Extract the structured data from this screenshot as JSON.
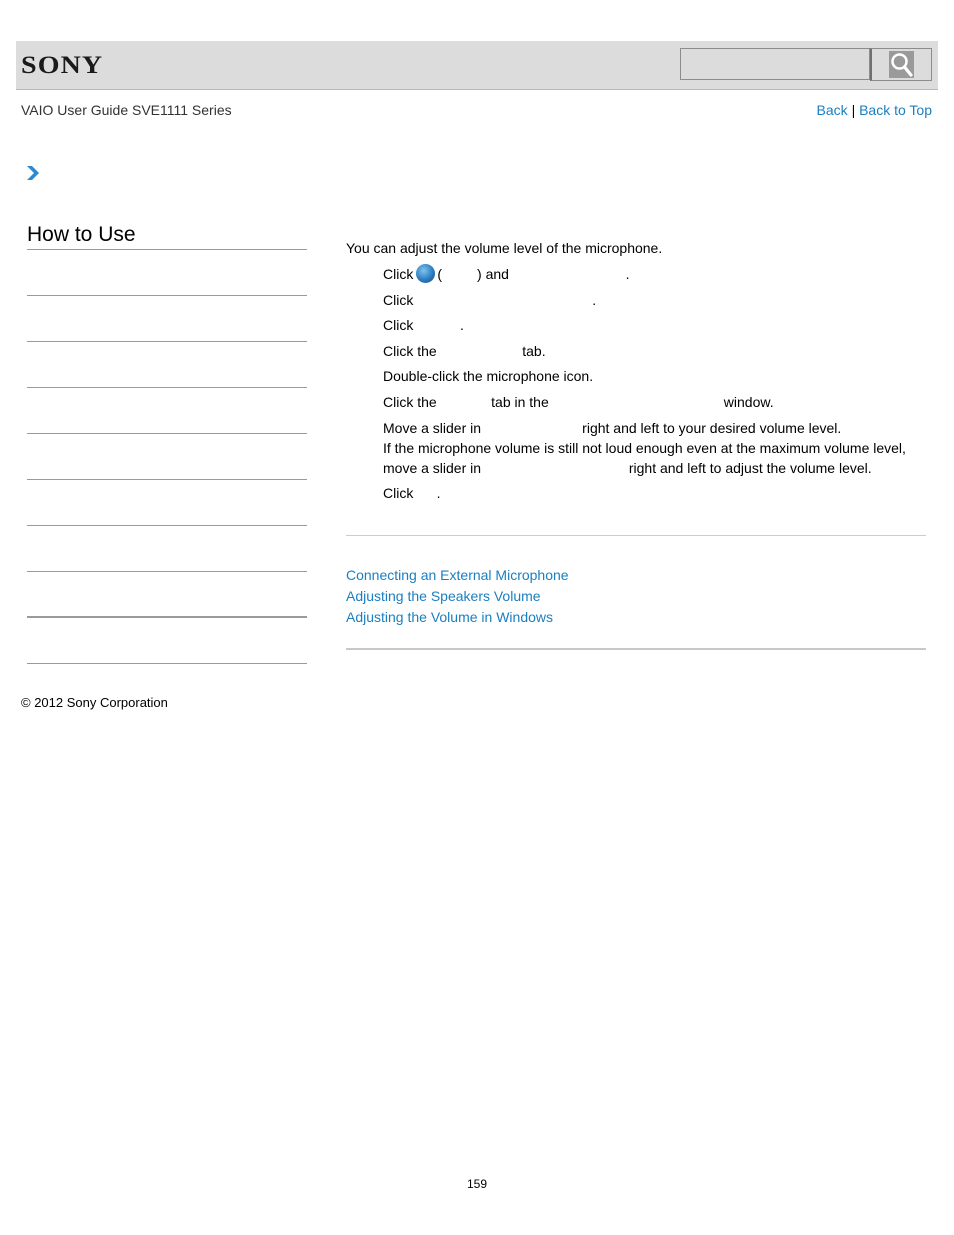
{
  "header": {
    "logo_text": "SONY",
    "search": {
      "value": "",
      "placeholder": ""
    },
    "search_icon": "search-icon"
  },
  "subheader": {
    "guide_title": "VAIO User Guide SVE1111 Series",
    "back_label": "Back",
    "separator": "|",
    "back_to_top_label": "Back to Top"
  },
  "breadcrumb": {
    "icon": "chevron-right-icon"
  },
  "sidebar": {
    "title": "How to Use",
    "item_count": 9
  },
  "content": {
    "intro": "You can adjust the volume level of the microphone.",
    "steps": [
      {
        "before": "Click",
        "icon": "windows-start-icon",
        "after": "(         ) and                              ."
      },
      {
        "text": "Click                                              ."
      },
      {
        "text": "Click            ."
      },
      {
        "text": "Click the                      tab."
      },
      {
        "text": "Double-click the microphone icon."
      },
      {
        "text": "Click the              tab in the                                             window."
      },
      {
        "line1": "Move a slider in                          right and left to your desired volume level.",
        "line2": "If the microphone volume is still not loud enough even at the maximum volume level,",
        "line3": "move a slider in                                      right and left to adjust the volume level."
      },
      {
        "text": "Click      ."
      }
    ]
  },
  "related_links": [
    "Connecting an External Microphone",
    "Adjusting the Speakers Volume",
    "Adjusting the Volume in Windows"
  ],
  "footer": {
    "copyright": "© 2012 Sony Corporation",
    "page_number": "159"
  },
  "colors": {
    "link": "#1a7fc1",
    "header_bg": "#dcdcdc",
    "rule": "#9a9a9a"
  }
}
